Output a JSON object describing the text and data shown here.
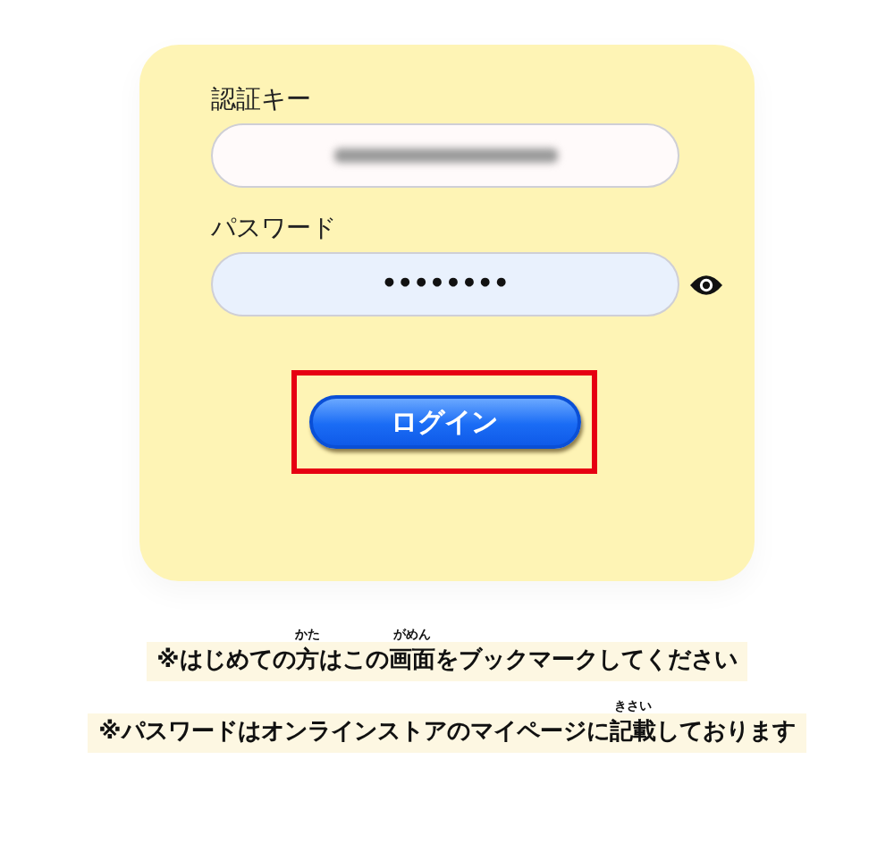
{
  "form": {
    "fields": [
      {
        "label": "認証キー",
        "kind": "blurred"
      },
      {
        "label": "パスワード",
        "kind": "password",
        "value": "••••••••",
        "reveal_icon": true
      }
    ],
    "login_button": {
      "label": "ログイン",
      "highlighted": true
    }
  },
  "notes": [
    [
      {
        "text": "※はじめての"
      },
      {
        "text": "方",
        "ruby": "かた"
      },
      {
        "text": "はこの"
      },
      {
        "text": "画面",
        "ruby": "がめん"
      },
      {
        "text": "をブックマークしてください"
      }
    ],
    [
      {
        "text": "※パスワードはオンラインストアのマイページに"
      },
      {
        "text": "記載",
        "ruby": "きさい"
      },
      {
        "text": "しております"
      }
    ]
  ]
}
